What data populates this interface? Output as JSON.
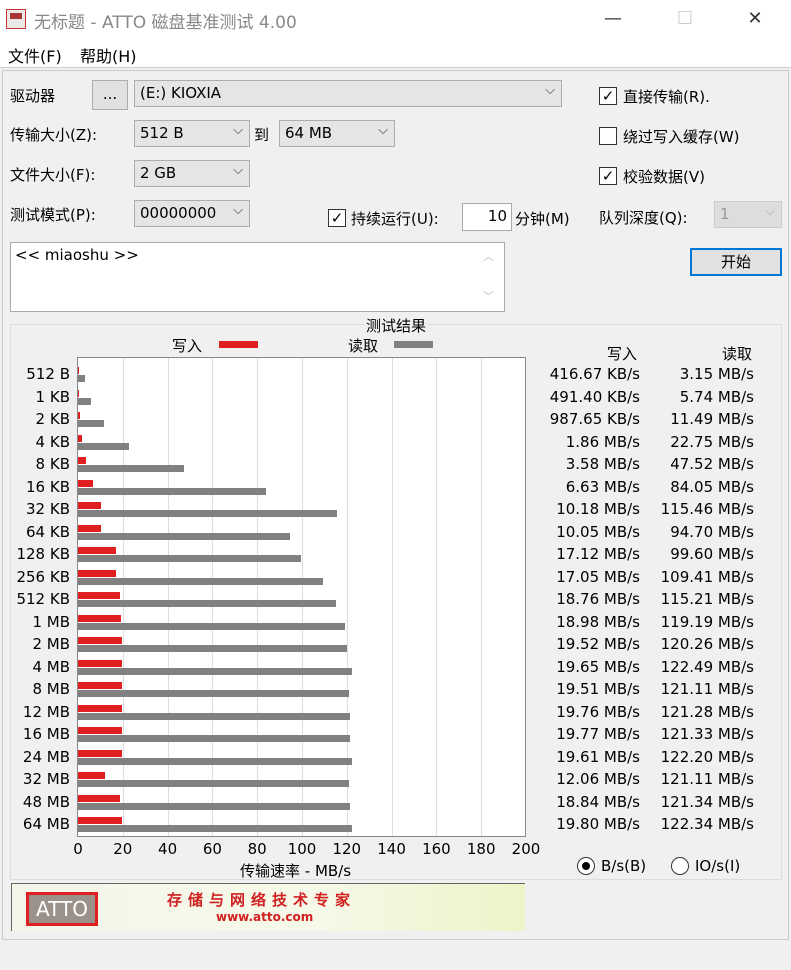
{
  "window": {
    "title": "无标题 - ATTO 磁盘基准测试 4.00",
    "minimize": "—",
    "maximize": "☐",
    "close": "✕"
  },
  "menu": [
    "文件(F)",
    "帮助(H)"
  ],
  "drive": {
    "label": "驱动器",
    "browse": "...",
    "value": "(E:) KIOXIA"
  },
  "transfer": {
    "label": "传输大小(Z):",
    "from": "512 B",
    "to_label": "到",
    "to": "64 MB"
  },
  "file_size": {
    "label": "文件大小(F):",
    "value": "2 GB"
  },
  "test_mode": {
    "label": "测试模式(P):",
    "value": "00000000"
  },
  "continuous": {
    "label": "持续运行(U):",
    "checked": true,
    "minutes": "10",
    "unit": "分钟(M)"
  },
  "options": {
    "direct": {
      "label": "直接传输(R).",
      "checked": true
    },
    "bypass": {
      "label": "绕过写入缓存(W)",
      "checked": false
    },
    "verify": {
      "label": "校验数据(V)",
      "checked": true
    },
    "queue": {
      "label": "队列深度(Q):",
      "value": "1"
    }
  },
  "description": "<< miaoshu >>",
  "start_button": "开始",
  "results": {
    "title": "测试结果",
    "legend_write": "写入",
    "legend_read": "读取",
    "col_write": "写入",
    "col_read": "读取",
    "write_display": [
      "416.67 KB/s",
      "491.40 KB/s",
      "987.65 KB/s",
      "1.86 MB/s",
      "3.58 MB/s",
      "6.63 MB/s",
      "10.18 MB/s",
      "10.05 MB/s",
      "17.12 MB/s",
      "17.05 MB/s",
      "18.76 MB/s",
      "18.98 MB/s",
      "19.52 MB/s",
      "19.65 MB/s",
      "19.51 MB/s",
      "19.76 MB/s",
      "19.77 MB/s",
      "19.61 MB/s",
      "12.06 MB/s",
      "18.84 MB/s",
      "19.80 MB/s"
    ],
    "read_display": [
      "3.15 MB/s",
      "5.74 MB/s",
      "11.49 MB/s",
      "22.75 MB/s",
      "47.52 MB/s",
      "84.05 MB/s",
      "115.46 MB/s",
      "94.70 MB/s",
      "99.60 MB/s",
      "109.41 MB/s",
      "115.21 MB/s",
      "119.19 MB/s",
      "120.26 MB/s",
      "122.49 MB/s",
      "121.11 MB/s",
      "121.28 MB/s",
      "121.33 MB/s",
      "122.20 MB/s",
      "121.11 MB/s",
      "121.34 MB/s",
      "122.34 MB/s"
    ]
  },
  "units": {
    "bytes": {
      "label": "B/s(B)",
      "selected": true
    },
    "io": {
      "label": "IO/s(I)",
      "selected": false
    }
  },
  "banner": {
    "logo": "ATTO",
    "slogan": "存储与网络技术专家",
    "url": "www.atto.com"
  },
  "chart_data": {
    "type": "bar",
    "orientation": "horizontal",
    "xlabel": "传输速率 - MB/s",
    "xlim": [
      0,
      200
    ],
    "xticks": [
      0,
      20,
      40,
      60,
      80,
      100,
      120,
      140,
      160,
      180,
      200
    ],
    "categories": [
      "512 B",
      "1 KB",
      "2 KB",
      "4 KB",
      "8 KB",
      "16 KB",
      "32 KB",
      "64 KB",
      "128 KB",
      "256 KB",
      "512 KB",
      "1 MB",
      "2 MB",
      "4 MB",
      "8 MB",
      "12 MB",
      "16 MB",
      "24 MB",
      "32 MB",
      "48 MB",
      "64 MB"
    ],
    "series": [
      {
        "name": "写入",
        "color": "#e02020",
        "values": [
          0.417,
          0.491,
          0.988,
          1.86,
          3.58,
          6.63,
          10.18,
          10.05,
          17.12,
          17.05,
          18.76,
          18.98,
          19.52,
          19.65,
          19.51,
          19.76,
          19.77,
          19.61,
          12.06,
          18.84,
          19.8
        ]
      },
      {
        "name": "读取",
        "color": "#808080",
        "values": [
          3.15,
          5.74,
          11.49,
          22.75,
          47.52,
          84.05,
          115.46,
          94.7,
          99.6,
          109.41,
          115.21,
          119.19,
          120.26,
          122.49,
          121.11,
          121.28,
          121.33,
          122.2,
          121.11,
          121.34,
          122.34
        ]
      }
    ]
  }
}
